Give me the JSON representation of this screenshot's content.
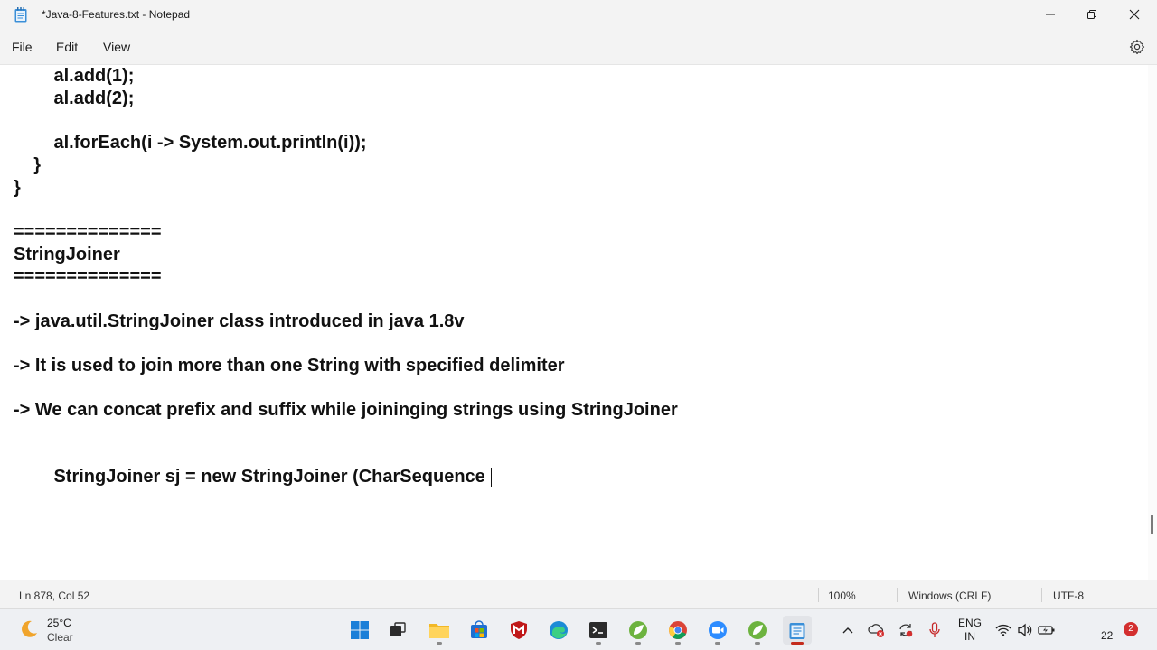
{
  "window": {
    "title": "*Java-8-Features.txt - Notepad"
  },
  "menu": {
    "file": "File",
    "edit": "Edit",
    "view": "View"
  },
  "editor": {
    "lines": [
      "        al.add(1);",
      "        al.add(2);",
      "",
      "        al.forEach(i -> System.out.println(i));",
      "    }",
      "}",
      "",
      "==============",
      "StringJoiner",
      "==============",
      "",
      "-> java.util.StringJoiner class introduced in java 1.8v",
      "",
      "-> It is used to join more than one String with specified delimiter",
      "",
      "-> We can concat prefix and suffix while joininging strings using StringJoiner",
      "",
      "",
      "        StringJoiner sj = new StringJoiner (CharSequence"
    ]
  },
  "status": {
    "position": "Ln 878, Col 52",
    "zoom": "100%",
    "line_ending": "Windows (CRLF)",
    "encoding": "UTF-8"
  },
  "taskbar": {
    "weather_temp": "25°C",
    "weather_cond": "Clear",
    "lang_top": "ENG",
    "lang_bottom": "IN",
    "clock": "22",
    "notifications": "2",
    "apps": [
      "start-icon",
      "task-view-icon",
      "file-explorer-icon",
      "store-icon",
      "mcafee-icon",
      "edge-icon",
      "terminal-icon",
      "spring-tool-icon",
      "chrome-icon",
      "zoom-icon",
      "spring-tool-2-icon",
      "notepad-icon"
    ]
  },
  "colors": {
    "accent": "#0067c0",
    "notification": "#d32f2f"
  }
}
